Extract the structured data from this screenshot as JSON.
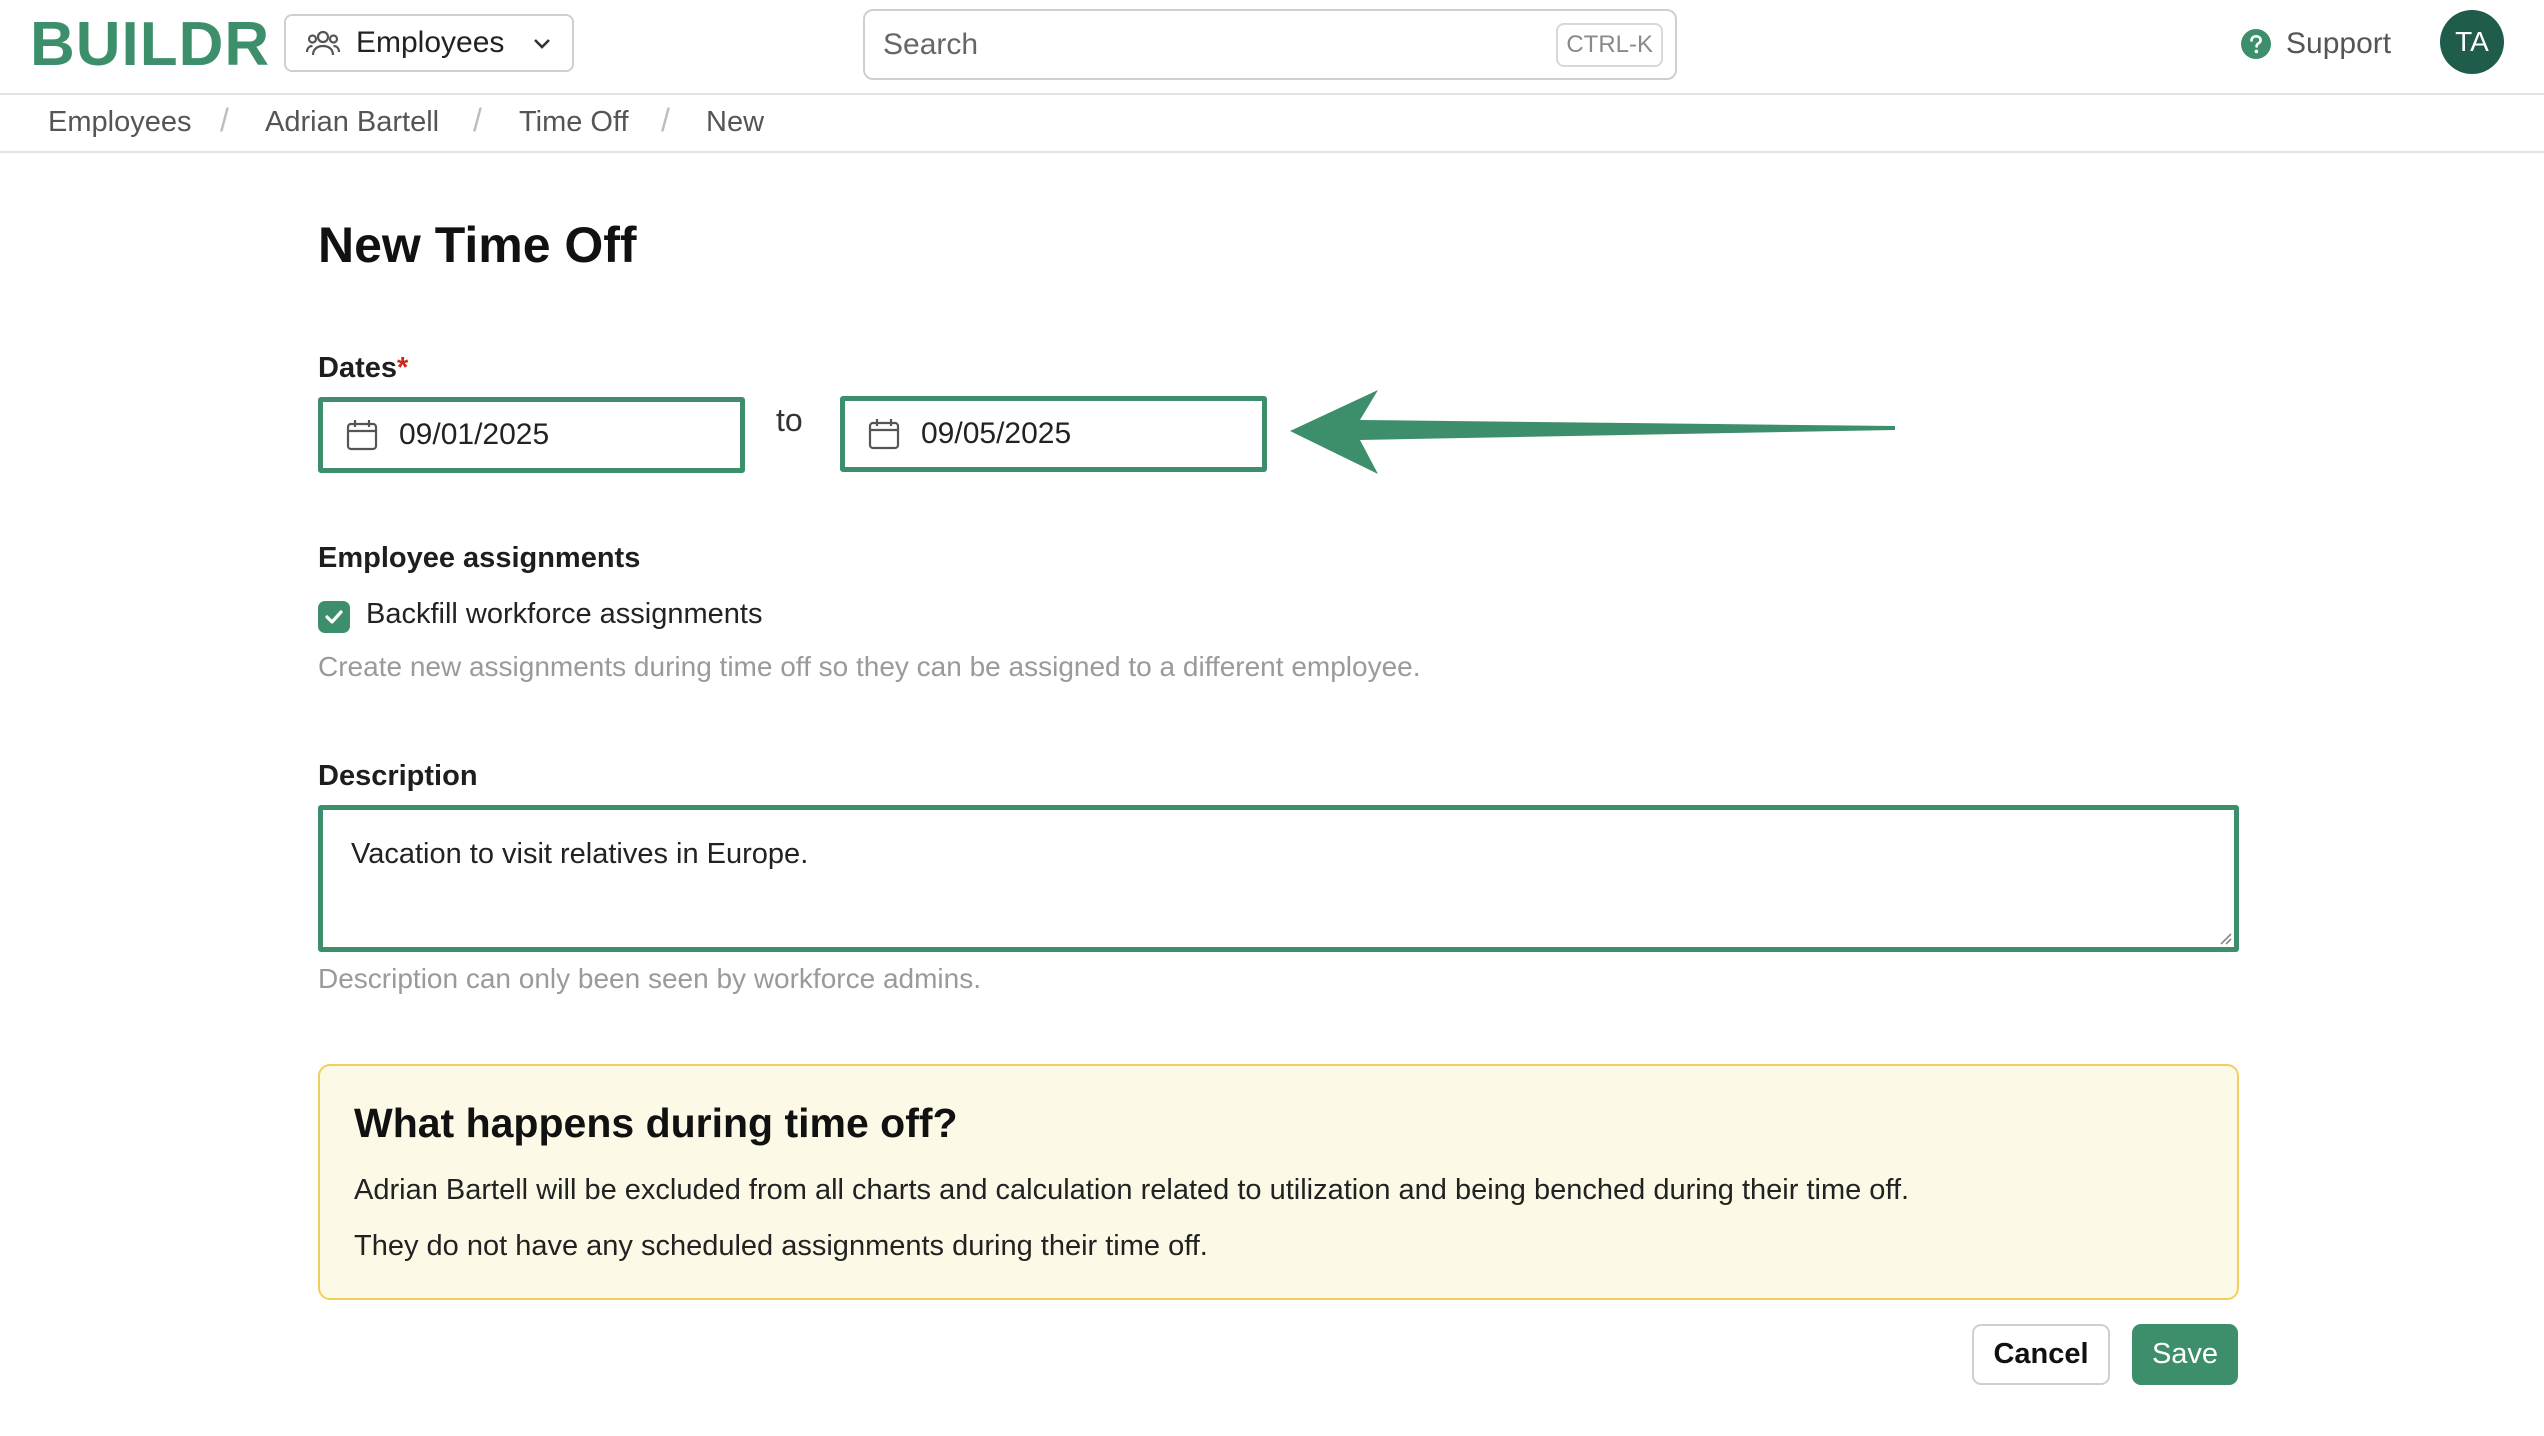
{
  "colors": {
    "brand": "#3d8f6c",
    "avatar": "#1f5c4b",
    "required": "#d0281d",
    "info_bg": "#fdf9e7",
    "info_border": "#f1cf5c"
  },
  "header": {
    "logo": "BUILDR",
    "module_select": {
      "label": "Employees",
      "icon": "users-icon"
    },
    "search": {
      "placeholder": "Search",
      "shortcut": "CTRL-K"
    },
    "support": {
      "label": "Support",
      "icon": "question-circle-icon"
    },
    "avatar_initials": "TA"
  },
  "breadcrumb": {
    "items": [
      "Employees",
      "Adrian Bartell",
      "Time Off",
      "New"
    ],
    "separator": "/"
  },
  "form": {
    "title": "New Time Off",
    "dates": {
      "label": "Dates",
      "required_marker": "*",
      "start": "09/01/2025",
      "to_label": "to",
      "end": "09/05/2025"
    },
    "assignments": {
      "label": "Employee assignments",
      "checkbox_label": "Backfill workforce assignments",
      "checked": true,
      "help": "Create new assignments during time off so they can be assigned to a different employee."
    },
    "description": {
      "label": "Description",
      "value": "Vacation to visit relatives in Europe.",
      "help": "Description can only been seen by workforce admins."
    }
  },
  "info": {
    "title": "What happens during time off?",
    "line1": "Adrian Bartell will be excluded from all charts and calculation related to utilization and being benched during their time off.",
    "line2": "They do not have any scheduled assignments during their time off."
  },
  "actions": {
    "cancel": "Cancel",
    "save": "Save"
  }
}
